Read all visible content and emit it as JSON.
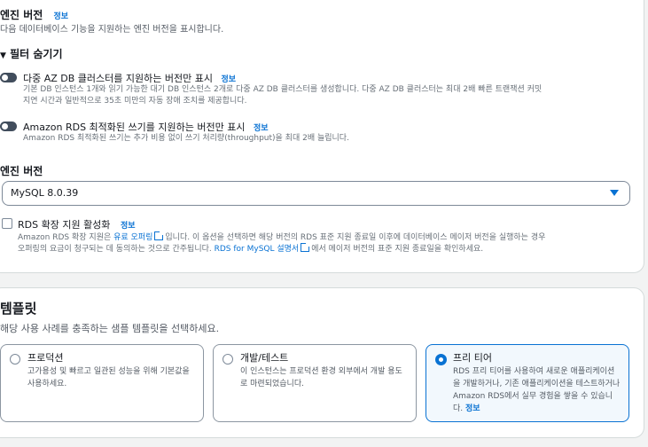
{
  "engine_version_section": {
    "title": "엔진 버전",
    "info": "정보",
    "description": "다음 데이터베이스 기능을 지원하는 엔진 버전을 표시합니다."
  },
  "filters": {
    "toggle_label": "필터 숨기기",
    "multi_az": {
      "label": "다중 AZ DB 클러스터를 지원하는 버전만 표시",
      "info": "정보",
      "desc_line1": "기본 DB 인스턴스 1개와 읽기 가능한 대기 DB 인스턴스 2개로 다중 AZ DB 클러스터를 생성합니다. 다중 AZ DB 클러스터는 최대 2배 빠른 트랜잭션 커밋",
      "desc_line2": "지연 시간과 일반적으로 35초 미만의 자동 장애 조치를 제공합니다."
    },
    "optimized_writes": {
      "label": "Amazon RDS 최적화된 쓰기를 지원하는 버전만 표시",
      "info": "정보",
      "desc": "Amazon RDS 최적화된 쓰기는 추가 비용 없이 쓰기 처리량(throughput)을 최대 2배 늘립니다."
    }
  },
  "engine_version": {
    "label": "엔진 버전",
    "selected": "MySQL 8.0.39"
  },
  "extended_support": {
    "label": "RDS 확장 지원 활성화",
    "info": "정보",
    "desc_part1": "Amazon RDS 확장 지원은 ",
    "link1": "유료 오퍼링",
    "desc_part2": "입니다. 이 옵션을 선택하면 해당 버전의 RDS 표준 지원 종료일 이후에 데이터베이스 메이저 버전을 실행하는 경우",
    "desc_part3": "오퍼링의 요금이 청구되는 데 동의하는 것으로 간주됩니다. ",
    "link2": "RDS for MySQL 설명서",
    "desc_part4": "에서 메이저 버전의 표준 지원 종료일을 확인하세요."
  },
  "templates": {
    "title": "템플릿",
    "description": "해당 사용 사례를 충족하는 샘플 템플릿을 선택하세요.",
    "options": [
      {
        "title": "프로덕션",
        "desc": "고가용성 및 빠르고 일관된 성능을 위해 기본값을 사용하세요."
      },
      {
        "title": "개발/테스트",
        "desc": "이 인스턴스는 프로덕션 환경 외부에서 개발 용도로 마련되었습니다."
      },
      {
        "title": "프리 티어",
        "desc": "RDS 프리 티어를 사용하여 새로운 애플리케이션을 개발하거나, 기존 애플리케이션을 테스트하거나 Amazon RDS에서 실무 경험을 쌓을 수 있습니다.",
        "info": "정보"
      }
    ],
    "selected_index": 2
  },
  "colors": {
    "accent": "#0972d3",
    "toggle_off": "#414d5c",
    "background": "#f2f3f3"
  }
}
